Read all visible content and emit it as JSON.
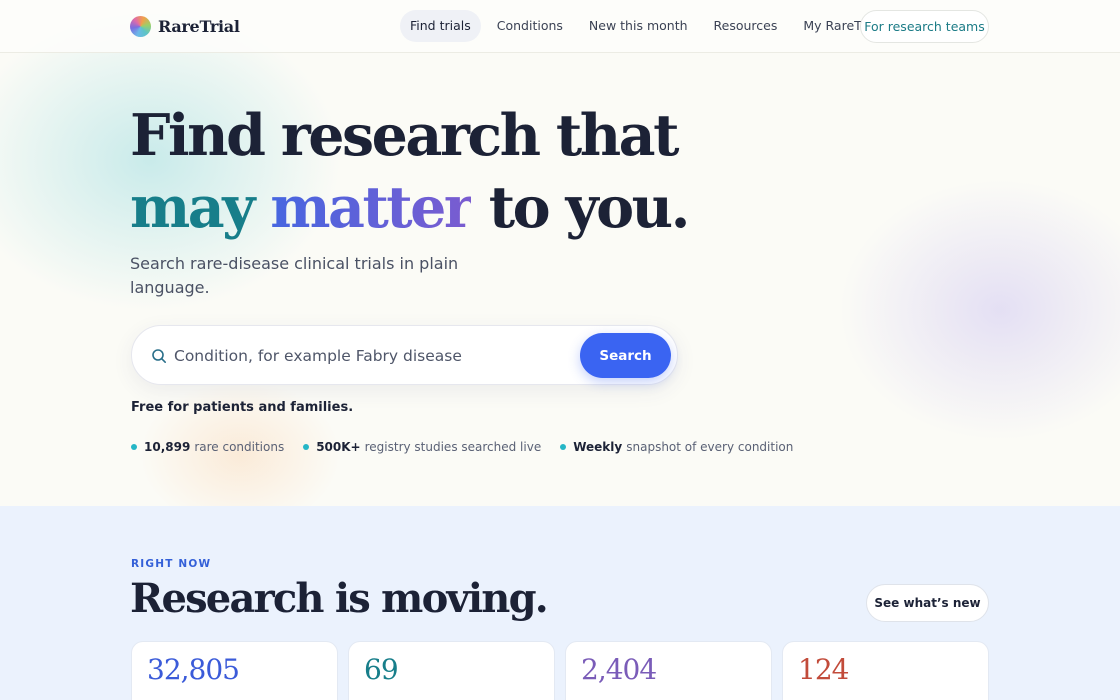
{
  "brand": {
    "name": "RareTrial",
    "logo_icon": "gradient-circle-logo"
  },
  "nav": {
    "links": [
      {
        "label": "Find trials",
        "active": true
      },
      {
        "label": "Conditions",
        "active": false
      },
      {
        "label": "New this month",
        "active": false
      },
      {
        "label": "Resources",
        "active": false
      },
      {
        "label": "My RareTrial",
        "active": false
      }
    ],
    "cta_label": "For research teams"
  },
  "hero": {
    "title_line1": "Find research that",
    "title_line2_part1": "may",
    "title_line2_part2": "matter",
    "title_line2_part3": "to you.",
    "subtitle": "Search rare-disease clinical trials in plain language.",
    "search": {
      "placeholder": "Condition, for example Fabry disease",
      "value": "",
      "button_label": "Search",
      "icon": "search-icon"
    },
    "free_note": "Free for patients and families.",
    "stats": [
      {
        "strong": "10,899",
        "text": "rare conditions"
      },
      {
        "strong": "500K+",
        "text": "registry studies searched live"
      },
      {
        "strong": "Weekly",
        "text": "snapshot of every condition"
      }
    ]
  },
  "section2": {
    "eyebrow": "RIGHT NOW",
    "title": "Research is moving.",
    "button_label": "See what’s new",
    "cards": [
      {
        "number": "32,805",
        "color": "#3b5bd9"
      },
      {
        "number": "69",
        "color": "#177e8a"
      },
      {
        "number": "2,404",
        "color": "#7a5cb8"
      },
      {
        "number": "124",
        "color": "#c24b3a"
      }
    ]
  },
  "colors": {
    "accent": "#3a64f2",
    "teal": "#177e8a",
    "dot": "#25b6c6",
    "text": "#1c2236"
  }
}
